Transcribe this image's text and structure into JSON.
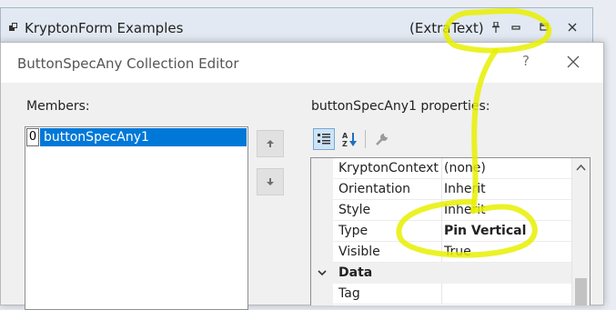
{
  "back_form": {
    "title": "KryptonForm Examples",
    "extra_text": "(ExtraText)",
    "icon": "form-icon",
    "buttons": [
      "pin-icon",
      "minimize-icon",
      "restore-icon",
      "close-icon"
    ]
  },
  "dialog": {
    "title": "ButtonSpecAny Collection Editor",
    "help_label": "?",
    "close_icon": "close-icon",
    "members_label": "Members:",
    "members": [
      {
        "index": "0",
        "name": "buttonSpecAny1"
      }
    ],
    "move_up_icon": "arrow-up-icon",
    "move_down_icon": "arrow-down-icon",
    "properties_label": "buttonSpecAny1 properties:",
    "toolbar_icons": [
      "categorized-icon",
      "alphabetical-icon",
      "property-pages-icon"
    ],
    "properties": [
      {
        "name": "KryptonContextM",
        "value": "(none)"
      },
      {
        "name": "Orientation",
        "value": "Inherit"
      },
      {
        "name": "Style",
        "value": "Inherit"
      },
      {
        "name": "Type",
        "value": "Pin Vertical"
      },
      {
        "name": "Visible",
        "value": "True"
      }
    ],
    "category": "Data",
    "category_properties": [
      {
        "name": "Tag",
        "value": ""
      }
    ]
  },
  "colors": {
    "highlight": "#e8f000",
    "selection": "#0078d7"
  }
}
